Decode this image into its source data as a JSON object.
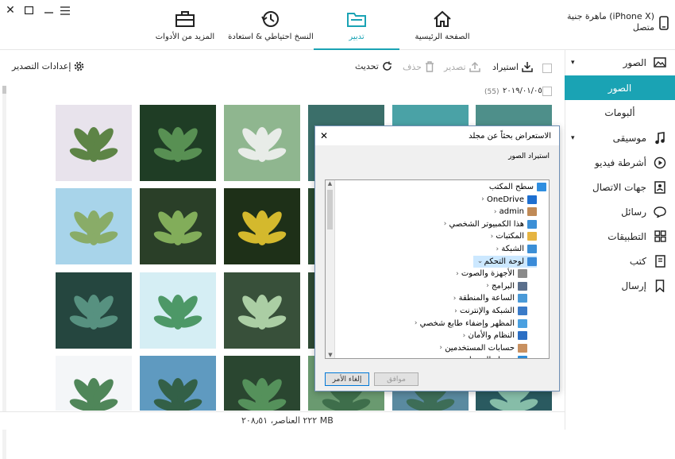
{
  "window_controls": {
    "close": "✕",
    "maximize": "☐",
    "minimize": "—",
    "menu": "☰"
  },
  "device": {
    "name": "ماهرة جنية (iPhone X)",
    "status": "متصل"
  },
  "nav": {
    "tabs": [
      {
        "label": "الصفحة الرئيسية",
        "icon": "home-icon"
      },
      {
        "label": "تدبير",
        "icon": "folder-icon",
        "active": true
      },
      {
        "label": "النسخ احتياطي & استعادة",
        "icon": "backup-restore-icon"
      },
      {
        "label": "المزيد من الأدوات",
        "icon": "toolbox-icon"
      }
    ]
  },
  "sidebar": {
    "items": [
      {
        "label": "الصور",
        "icon": "image-icon"
      },
      {
        "label": "الصور",
        "sub": true,
        "active": true
      },
      {
        "label": "ألبومات",
        "sub": true
      },
      {
        "label": "موسيقى",
        "icon": "music-icon"
      },
      {
        "label": "أشرطة فيديو",
        "icon": "video-icon"
      },
      {
        "label": "جهات الاتصال",
        "icon": "contacts-icon"
      },
      {
        "label": "رسائل",
        "icon": "messages-icon"
      },
      {
        "label": "التطبيقات",
        "icon": "apps-icon"
      },
      {
        "label": "كتب",
        "icon": "books-icon"
      },
      {
        "label": "إرسال",
        "icon": "bookmark-icon"
      }
    ]
  },
  "toolbar": {
    "import": "استيراد",
    "export": "تصدير",
    "delete": "حذف",
    "refresh": "تحديث",
    "export_settings": "إعدادات التصدير"
  },
  "group": {
    "date": "٢٠١٩/٠١/٠٥",
    "count": "(55)"
  },
  "status": {
    "text": "٢٢٢ العناصر، ٢٠٨٫٥١ MB"
  },
  "dialog": {
    "title": "الاستعراض بحثاً عن مجلد",
    "subtitle": "استيراد الصور",
    "ok": "موافق",
    "cancel": "إلغاء الأمر",
    "close": "✕",
    "tree": [
      {
        "label": "سطح المكتب",
        "indent": 0,
        "color": "#2f8ee0",
        "expand": ""
      },
      {
        "label": "OneDrive",
        "indent": 1,
        "color": "#1e6fd0",
        "expand": "›"
      },
      {
        "label": "admin",
        "indent": 1,
        "color": "#c08a56",
        "expand": "›"
      },
      {
        "label": "هذا الكمبيوتر الشخصي",
        "indent": 1,
        "color": "#3b8fd6",
        "expand": "›"
      },
      {
        "label": "المكتبات",
        "indent": 1,
        "color": "#e6b440",
        "expand": "›"
      },
      {
        "label": "الشبكة",
        "indent": 1,
        "color": "#3b8fd6",
        "expand": "›"
      },
      {
        "label": "لوحة التحكم",
        "indent": 1,
        "color": "#3a8bd8",
        "expand": "⌄",
        "selected": true
      },
      {
        "label": "الأجهزة والصوت",
        "indent": 2,
        "color": "#8a8a8a",
        "expand": "›"
      },
      {
        "label": "البرامج",
        "indent": 2,
        "color": "#5a6f8c",
        "expand": "›"
      },
      {
        "label": "الساعة والمنطقة",
        "indent": 2,
        "color": "#4a9ad8",
        "expand": "›"
      },
      {
        "label": "الشبكة والإنترنت",
        "indent": 2,
        "color": "#3a7bc8",
        "expand": "›"
      },
      {
        "label": "المظهر وإضفاء طابع شخصي",
        "indent": 2,
        "color": "#4aa0e0",
        "expand": "›"
      },
      {
        "label": "النظام والأمان",
        "indent": 2,
        "color": "#2c6fc4",
        "expand": "›"
      },
      {
        "label": "حسابات المستخدمين",
        "indent": 2,
        "color": "#c89060",
        "expand": "›"
      },
      {
        "label": "سهولة الوصول",
        "indent": 2,
        "color": "#2c8cd8",
        "expand": "›"
      }
    ]
  },
  "photos": [
    {
      "bg": "#e8e3ec",
      "fg": "#4e7a35"
    },
    {
      "bg": "#1f3d25",
      "fg": "#5f9a58"
    },
    {
      "bg": "#8fb68f",
      "fg": "#f2f2f2"
    },
    {
      "bg": "#3b6f6a",
      "fg": "#a8d0c0"
    },
    {
      "bg": "#4aa2a6",
      "fg": "#2f6f6a"
    },
    {
      "bg": "#4e8f8a",
      "fg": "#7fc0b8"
    },
    {
      "bg": "#a8d4ea",
      "fg": "#86a85a"
    },
    {
      "bg": "#2a3f28",
      "fg": "#8cba60"
    },
    {
      "bg": "#1e3018",
      "fg": "#e8c830"
    },
    {
      "bg": "#2a4a30",
      "fg": "#6f9a50"
    },
    {
      "bg": "#4d8a40",
      "fg": "#9cc46a"
    },
    {
      "bg": "#3a5a30",
      "fg": "#a0c070"
    },
    {
      "bg": "#25463f",
      "fg": "#5d9a88"
    },
    {
      "bg": "#d5eef4",
      "fg": "#3f8f58"
    },
    {
      "bg": "#38503a",
      "fg": "#b8dcb0"
    },
    {
      "bg": "#2e4a34",
      "fg": "#6a9a70"
    },
    {
      "bg": "#3a6050",
      "fg": "#7ab090"
    },
    {
      "bg": "#4a7060",
      "fg": "#90c0a8"
    },
    {
      "bg": "#f4f6f8",
      "fg": "#3e7a48"
    },
    {
      "bg": "#5f9ac0",
      "fg": "#2f5a3a"
    },
    {
      "bg": "#2a4630",
      "fg": "#5a9a60"
    },
    {
      "bg": "#6a9a70",
      "fg": "#3a6a48"
    },
    {
      "bg": "#5a8aa0",
      "fg": "#3a6a50"
    },
    {
      "bg": "#2a5a60",
      "fg": "#90c8b0"
    }
  ]
}
